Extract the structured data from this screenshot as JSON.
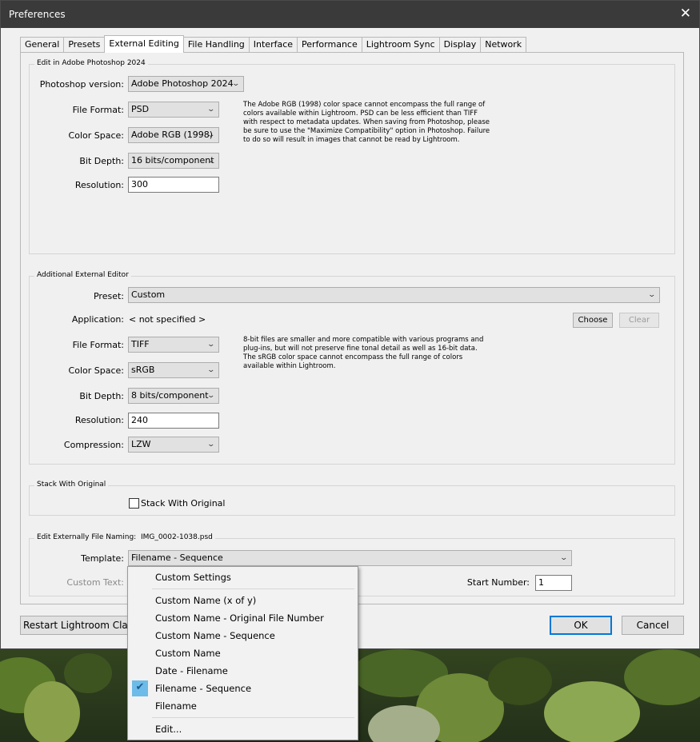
{
  "window": {
    "title": "Preferences"
  },
  "tabs": [
    "General",
    "Presets",
    "External Editing",
    "File Handling",
    "Interface",
    "Performance",
    "Lightroom Sync",
    "Display",
    "Network"
  ],
  "photoshop": {
    "group_title": "Edit in Adobe Photoshop 2024",
    "version_label": "Photoshop version:",
    "version_value": "Adobe Photoshop 2024",
    "file_format_label": "File Format:",
    "file_format_value": "PSD",
    "color_space_label": "Color Space:",
    "color_space_value": "Adobe RGB (1998)",
    "bit_depth_label": "Bit Depth:",
    "bit_depth_value": "16 bits/component",
    "resolution_label": "Resolution:",
    "resolution_value": "300",
    "note_lines": [
      "The Adobe RGB (1998) color space cannot encompass the full range of",
      "colors available within Lightroom. PSD can be less efficient than TIFF",
      "with respect to metadata updates. When saving from Photoshop, please",
      "be sure to use the \"Maximize Compatibility\" option in Photoshop. Failure",
      "to do so will result in images that cannot be read by Lightroom."
    ]
  },
  "additional": {
    "group_title": "Additional External Editor",
    "preset_label": "Preset:",
    "preset_value": "Custom",
    "application_label": "Application:",
    "application_value": "< not specified >",
    "choose_button": "Choose",
    "clear_button": "Clear",
    "file_format_label": "File Format:",
    "file_format_value": "TIFF",
    "color_space_label": "Color Space:",
    "color_space_value": "sRGB",
    "bit_depth_label": "Bit Depth:",
    "bit_depth_value": "8 bits/component",
    "resolution_label": "Resolution:",
    "resolution_value": "240",
    "compression_label": "Compression:",
    "compression_value": "LZW",
    "note_lines": [
      "8-bit files are smaller and more compatible with various programs and",
      "plug-ins, but will not preserve fine tonal detail as well as 16-bit data.",
      "The sRGB color space cannot encompass the full range of colors",
      "available within Lightroom."
    ]
  },
  "stack": {
    "group_title": "Stack With Original",
    "checkbox_label": "Stack With Original",
    "checked": false
  },
  "naming": {
    "group_title": "Edit Externally File Naming:",
    "example": "IMG_0002-1038.psd",
    "template_label": "Template:",
    "template_value": "Filename - Sequence",
    "custom_text_label": "Custom Text:",
    "start_number_label": "Start Number:",
    "start_number_value": "1"
  },
  "menu": {
    "items": [
      "Custom Settings",
      "Custom Name (x of y)",
      "Custom Name - Original File Number",
      "Custom Name - Sequence",
      "Custom Name",
      "Date - Filename",
      "Filename - Sequence",
      "Filename",
      "Edit..."
    ],
    "selected": "Filename - Sequence"
  },
  "footer": {
    "restart_button": "Restart Lightroom Clas",
    "ok_button": "OK",
    "cancel_button": "Cancel"
  },
  "colors": {
    "titlebar": "#3a3a3a",
    "accent": "#0078d7",
    "menu_check_highlight": "#6dbbe8"
  }
}
